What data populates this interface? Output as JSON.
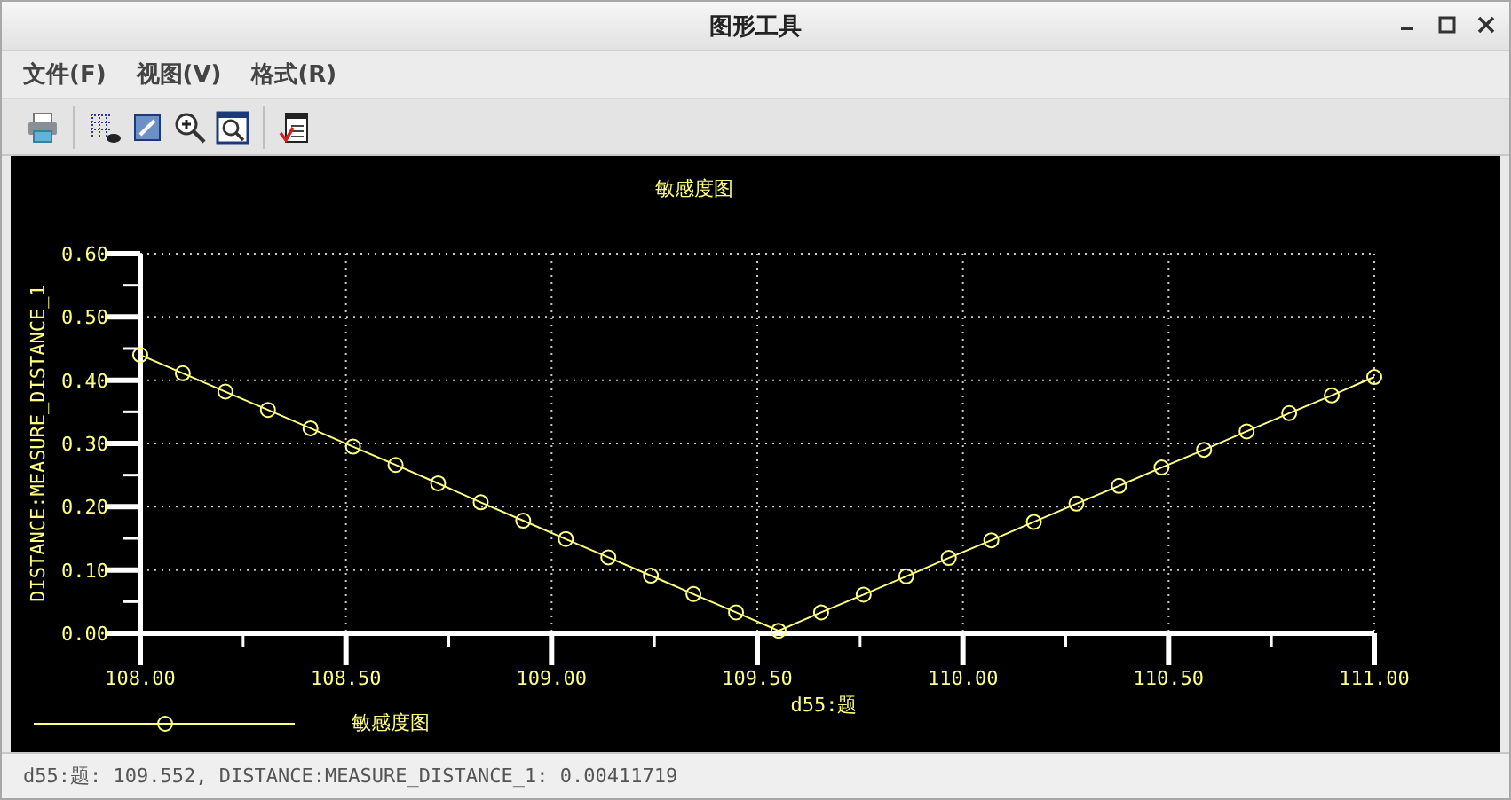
{
  "window": {
    "title": "图形工具"
  },
  "menu": [
    "文件(F)",
    "视图(V)",
    "格式(R)"
  ],
  "toolbar": [
    {
      "kind": "print"
    },
    {
      "kind": "grid"
    },
    {
      "kind": "edit"
    },
    {
      "kind": "zoom-in"
    },
    {
      "kind": "zoom-window"
    },
    {
      "kind": "report"
    }
  ],
  "chart": {
    "chart_data": {
      "type": "line",
      "title": "敏感度图",
      "xlabel": "d55:题",
      "ylabel": "DISTANCE:MEASURE_DISTANCE_1",
      "x": [
        108,
        108.1034,
        108.2069,
        108.3103,
        108.4138,
        108.5172,
        108.6207,
        108.7241,
        108.8276,
        108.931,
        109.0345,
        109.1379,
        109.2414,
        109.3448,
        109.4483,
        109.5517,
        109.6552,
        109.7586,
        109.8621,
        109.9655,
        110.069,
        110.1724,
        110.2759,
        110.3793,
        110.4828,
        110.5862,
        110.6897,
        110.7931,
        110.8966,
        111
      ],
      "series": [
        {
          "name": "敏感度图",
          "color": "#ffff80",
          "marker": "circle",
          "values": [
            0.44,
            0.411,
            0.382,
            0.353,
            0.324,
            0.295,
            0.266,
            0.237,
            0.207,
            0.178,
            0.149,
            0.12,
            0.091,
            0.062,
            0.033,
            0.004,
            0.033,
            0.061,
            0.09,
            0.119,
            0.147,
            0.176,
            0.205,
            0.233,
            0.262,
            0.29,
            0.319,
            0.348,
            0.376,
            0.405
          ]
        }
      ],
      "xlim": [
        108,
        111
      ],
      "ylim": [
        0,
        0.6
      ],
      "grid": true,
      "xticks": [
        {
          "value": 108,
          "label": "108.00"
        },
        {
          "value": 108.5,
          "label": "108.50"
        },
        {
          "value": 109,
          "label": "109.00"
        },
        {
          "value": 109.5,
          "label": "109.50"
        },
        {
          "value": 110,
          "label": "110.00"
        },
        {
          "value": 110.5,
          "label": "110.50"
        },
        {
          "value": 111,
          "label": "111.00"
        }
      ],
      "yticks": [
        {
          "value": 0,
          "label": "0.00"
        },
        {
          "value": 0.1,
          "label": "0.10"
        },
        {
          "value": 0.2,
          "label": "0.20"
        },
        {
          "value": 0.3,
          "label": "0.30"
        },
        {
          "value": 0.4,
          "label": "0.40"
        },
        {
          "value": 0.5,
          "label": "0.50"
        },
        {
          "value": 0.6,
          "label": "0.60"
        }
      ]
    }
  },
  "status_bar": "d55:题: 109.552, DISTANCE:MEASURE_DISTANCE_1: 0.00411719"
}
